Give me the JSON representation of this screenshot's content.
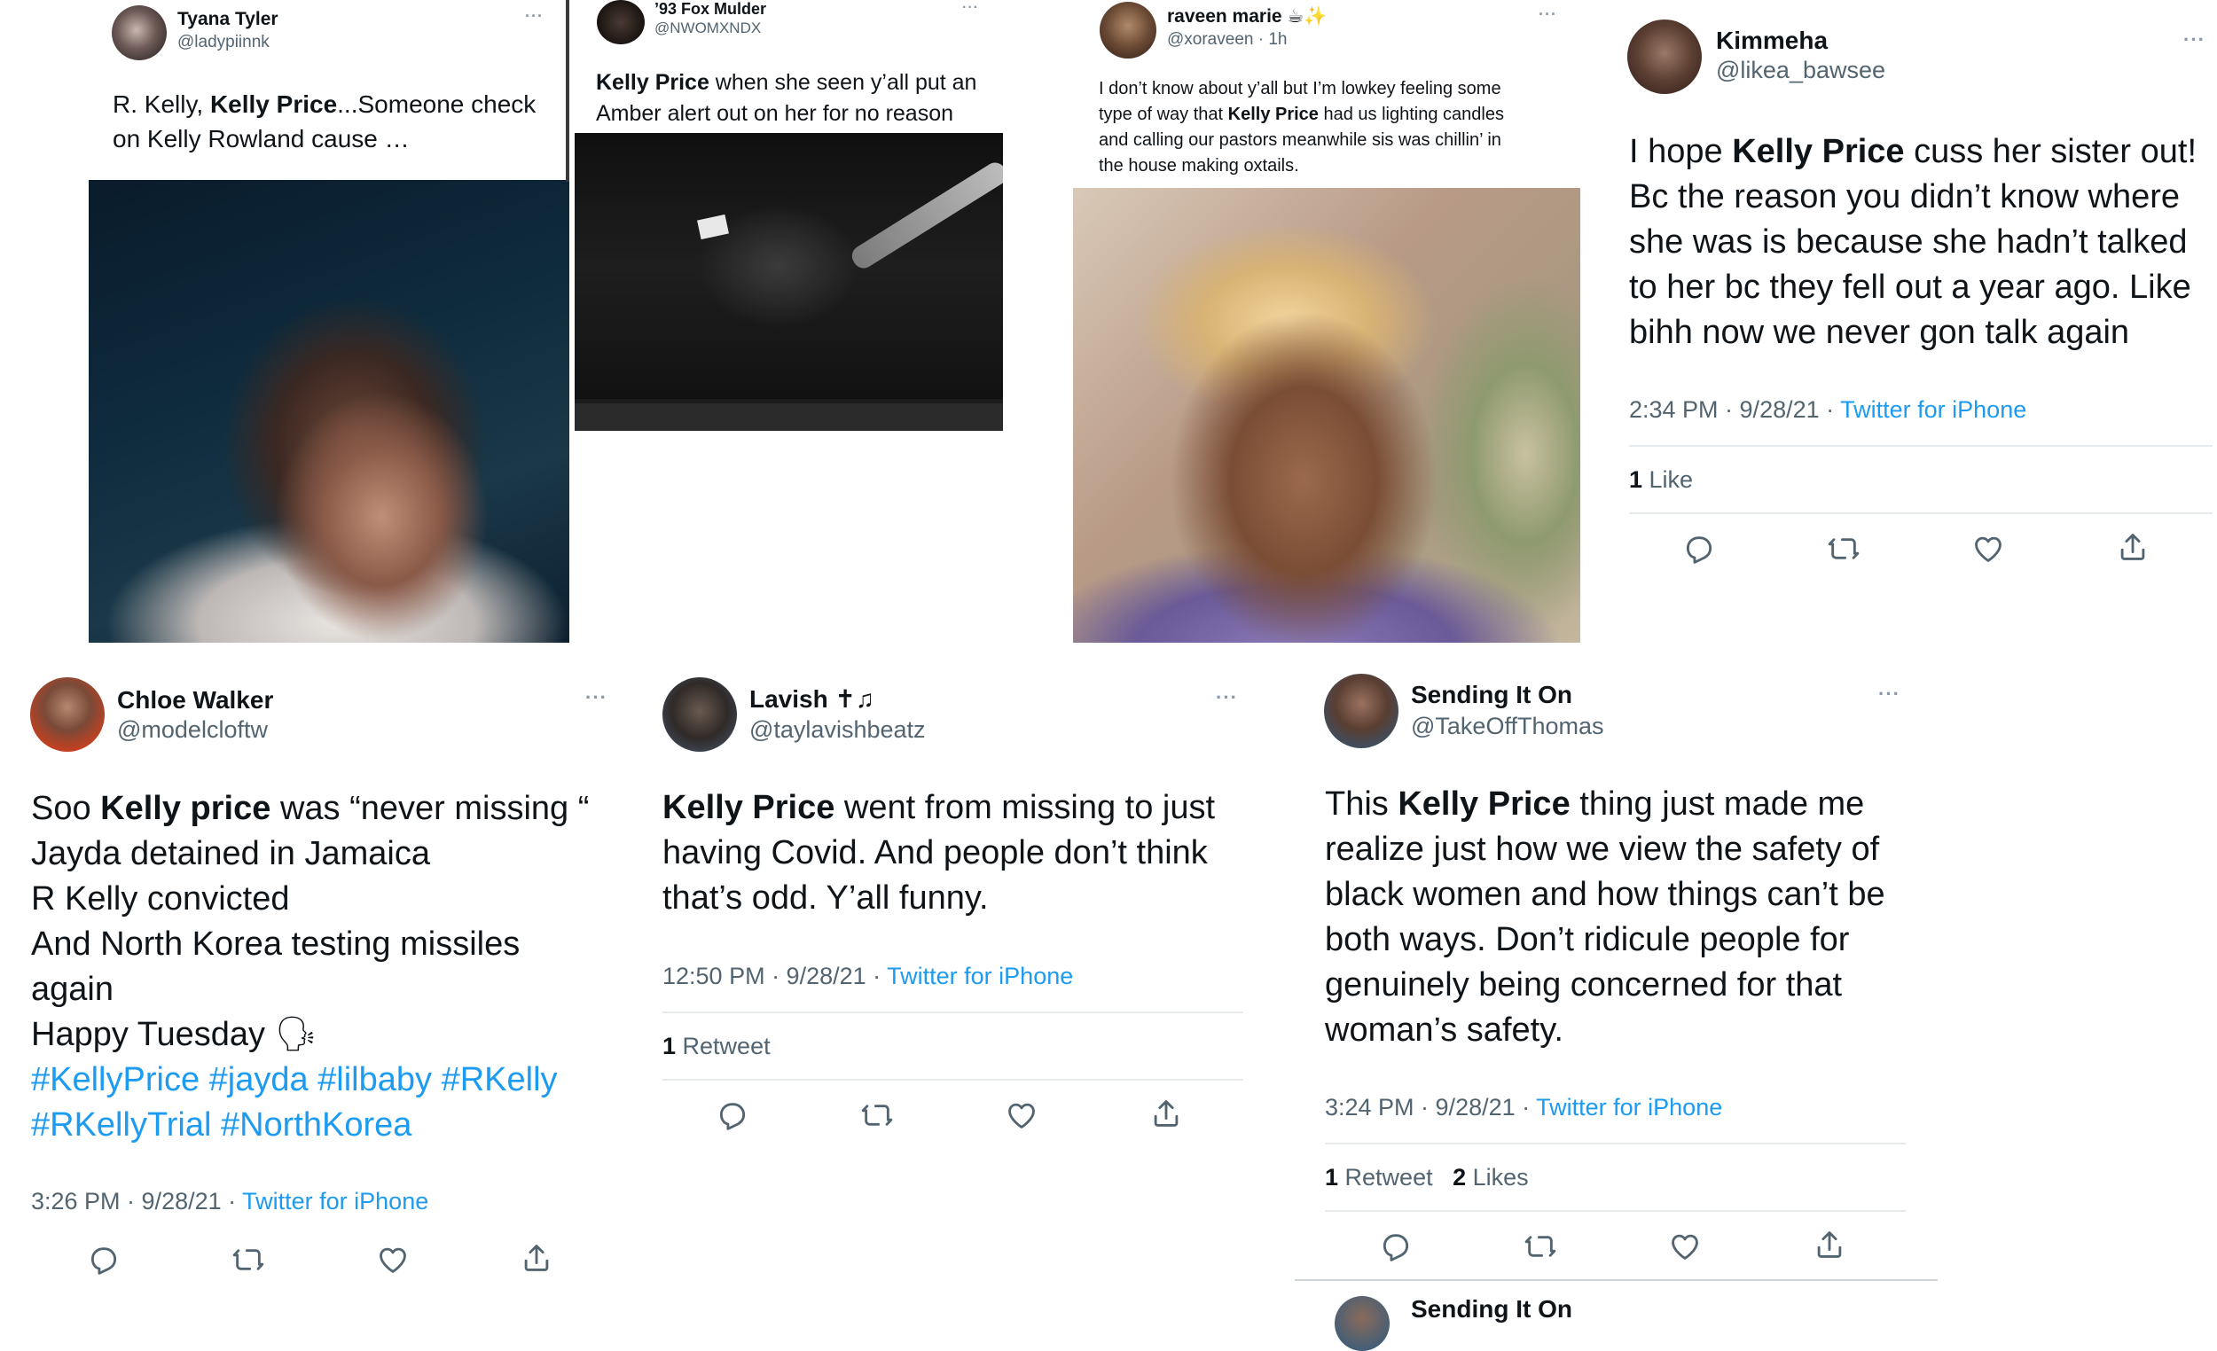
{
  "tweets": {
    "t1": {
      "name": "Tyana Tyler",
      "handle": "@ladypiinnk",
      "more": "···",
      "text_pre": "R. Kelly, ",
      "text_bold": "Kelly Price",
      "text_post": "...Someone check\non Kelly Rowland cause …"
    },
    "t2": {
      "name": "’93 Fox Mulder",
      "handle": "@NWOMXNDX",
      "more": "···",
      "text_bold": "Kelly Price",
      "text_post": " when she seen y’all put an\nAmber alert out on her for no reason"
    },
    "t3": {
      "name": "raveen marie ☕✨",
      "handle": "@xoraveen · 1h",
      "more": "···",
      "text_pre": "I don’t know about y’all but I’m lowkey feeling some\ntype of way that ",
      "text_bold": "Kelly Price",
      "text_post": " had us lighting candles\nand calling our pastors meanwhile sis was chillin’ in\nthe house making oxtails."
    },
    "t4": {
      "name": "Kimmeha",
      "handle": "@likea_bawsee",
      "more": "···",
      "text_pre": "I hope ",
      "text_bold": "Kelly Price",
      "text_post": " cuss her sister out!\nBc the reason you didn’t know where\nshe was is because she hadn’t talked\nto her bc they fell out a year ago. Like\nbihh now we never gon talk again",
      "time": "2:34 PM · 9/28/21 · ",
      "source": "Twitter for iPhone",
      "stat1_num": "1",
      "stat1_label": " Like"
    },
    "t5": {
      "name": "Chloe Walker",
      "handle": "@modelcloftw",
      "more": "···",
      "text_pre": "Soo ",
      "text_bold": "Kelly price",
      "text_post": " was “never missing “\nJayda detained in Jamaica\nR Kelly convicted\nAnd North Korea testing missiles\nagain\nHappy Tuesday 🗣",
      "hashtags1": "#KellyPrice #jayda #lilbaby #RKelly",
      "hashtags2": "#RKellyTrial #NorthKorea",
      "time": "3:26 PM · 9/28/21 · ",
      "source": "Twitter for iPhone"
    },
    "t6": {
      "name": "Lavish ✝♫",
      "handle": "@taylavishbeatz",
      "more": "···",
      "text_bold": "Kelly Price",
      "text_post": " went from missing to just\nhaving Covid. And people don’t think\nthat’s odd. Y’all funny.",
      "time": "12:50 PM · 9/28/21 · ",
      "source": "Twitter for iPhone",
      "stat1_num": "1",
      "stat1_label": " Retweet"
    },
    "t7": {
      "name": "Sending It On",
      "handle": "@TakeOffThomas",
      "more": "···",
      "text_pre": "This ",
      "text_bold": "Kelly Price",
      "text_post": " thing just made me\nrealize just how we view the safety of\nblack women and how things can’t be\nboth ways. Don’t ridicule people for\ngenuinely being concerned for that\nwoman’s safety.",
      "time": "3:24 PM · 9/28/21 · ",
      "source": "Twitter for iPhone",
      "stat1_num": "1",
      "stat1_label": " Retweet",
      "stat2_num": "2",
      "stat2_label": " Likes",
      "next_name": "Sending It On"
    }
  },
  "icons": [
    "reply-icon",
    "retweet-icon",
    "like-icon",
    "share-icon"
  ],
  "colors": {
    "link": "#1d9bf0",
    "muted": "#536471",
    "divider": "#e7eaec"
  }
}
